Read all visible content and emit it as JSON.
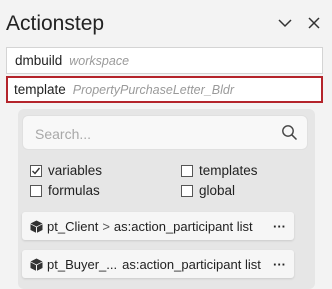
{
  "header": {
    "title": "Actionstep",
    "chevron_icon": "chevron-down-icon",
    "close_icon": "close-icon"
  },
  "fields": [
    {
      "key": "dmbuild",
      "value": "workspace",
      "selected": false
    },
    {
      "key": "template",
      "value": "PropertyPurchaseLetter_Bldr",
      "selected": true
    }
  ],
  "search": {
    "placeholder": "Search...",
    "value": "",
    "icon": "search-icon"
  },
  "filters": [
    {
      "label": "variables",
      "checked": true
    },
    {
      "label": "templates",
      "checked": false
    },
    {
      "label": "formulas",
      "checked": false
    },
    {
      "label": "global",
      "checked": false
    }
  ],
  "items": [
    {
      "icon": "cube-icon",
      "name": "pt_Client",
      "separator": ">",
      "type": "as:action_participant list",
      "more": "···"
    },
    {
      "icon": "cube-icon",
      "name": "pt_Buyer_...",
      "separator": "",
      "type": "as:action_participant list",
      "more": "···"
    }
  ],
  "colors": {
    "selected_border": "#b4242b",
    "panel_bg": "#e6e6e6",
    "page_bg": "#f3f3f3"
  }
}
